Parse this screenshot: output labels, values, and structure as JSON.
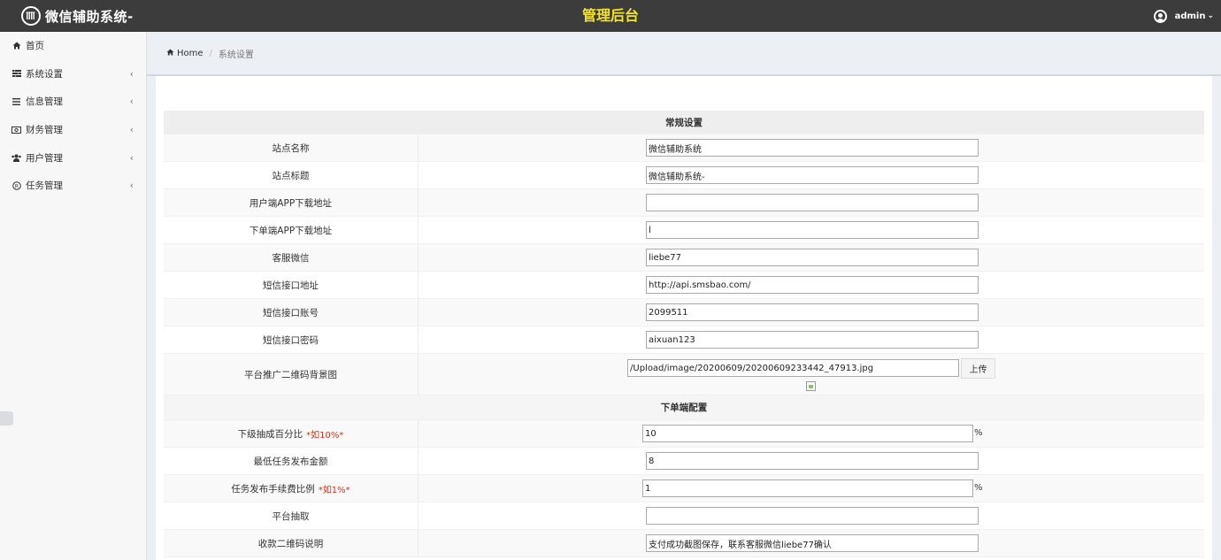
{
  "topbar": {
    "brand": "微信辅助系统-",
    "title": "管理后台",
    "user": "admin"
  },
  "sidebar": {
    "items": [
      {
        "label": "首页",
        "icon": "home-icon",
        "has_arrow": false
      },
      {
        "label": "系统设置",
        "icon": "settings-list-icon",
        "has_arrow": true
      },
      {
        "label": "信息管理",
        "icon": "list-icon",
        "has_arrow": true
      },
      {
        "label": "财务管理",
        "icon": "money-icon",
        "has_arrow": true
      },
      {
        "label": "用户管理",
        "icon": "users-icon",
        "has_arrow": true
      },
      {
        "label": "任务管理",
        "icon": "registered-icon",
        "has_arrow": true
      }
    ],
    "arrow": "‹"
  },
  "breadcrumb": {
    "home": "Home",
    "separator": "/",
    "current": "系统设置"
  },
  "sections": {
    "general": "常规设置",
    "order_config": "下单端配置"
  },
  "fields": [
    {
      "label": "站点名称",
      "value": ""
    },
    {
      "label": "站点标题",
      "value": ""
    },
    {
      "label": "用户端APP下载地址",
      "value": ""
    },
    {
      "label": "下单端APP下载地址",
      "value": "l"
    },
    {
      "label": "客服微信",
      "value": "liebe77"
    },
    {
      "label": "短信接口地址",
      "value": "http://api.smsbao.com/"
    },
    {
      "label": "短信接口账号",
      "value": "2099511"
    },
    {
      "label": "短信接口密码",
      "value": "aixuan123"
    }
  ],
  "field_values_display": {
    "site_name": "微信辅助系统",
    "site_title": "微信辅助系统-"
  },
  "upload": {
    "label": "平台推广二维码背景图",
    "value": "/Upload/image/20200609/20200609233442_47913.jpg",
    "button": "上传"
  },
  "order_fields": {
    "commission": {
      "label": "下级抽成百分比",
      "hint": "*如10%*",
      "value": "10",
      "suffix": "%"
    },
    "min_amount": {
      "label": "最低任务发布金额",
      "value": "8"
    },
    "fee_ratio": {
      "label": "任务发布手续费比例",
      "hint": "*如1%*",
      "value": "1",
      "suffix": "%"
    },
    "platform_cut": {
      "label": "平台抽取",
      "value": ""
    },
    "qr_note": {
      "label": "收款二维码说明",
      "value": "支付成功截图保存，联系客服微信liebe77确认"
    }
  },
  "colors": {
    "topbar": "#3c3c3c",
    "title": "#f5e42a",
    "hint": "#c0392b"
  }
}
